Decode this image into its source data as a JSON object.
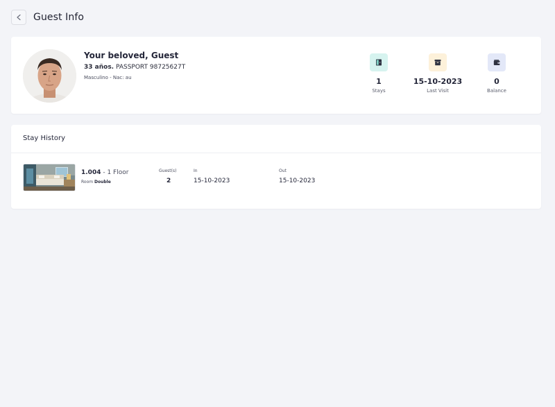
{
  "header": {
    "title": "Guest Info"
  },
  "guest": {
    "name": "Your beloved, Guest",
    "age": "33 años.",
    "passport": "PASSPORT 98725627T",
    "meta": "Masculino - Nac: au"
  },
  "stats": [
    {
      "value": "1",
      "label": "Stays",
      "icon": "door-icon",
      "color": "#d6f3ef"
    },
    {
      "value": "15-10-2023",
      "label": "Last Visit",
      "icon": "archive-icon",
      "color": "#fdf1da"
    },
    {
      "value": "0",
      "label": "Balance",
      "icon": "wallet-icon",
      "color": "#e3e8f8"
    }
  ],
  "history": {
    "title": "Stay History",
    "stays": [
      {
        "room_number": "1.004",
        "floor": "1 Floor",
        "room_label": "Room",
        "room_type": "Double",
        "guests_label": "Guest(s)",
        "guests": "2",
        "in_label": "In",
        "in_date": "15-10-2023",
        "out_label": "Out",
        "out_date": "15-10-2023"
      }
    ]
  }
}
